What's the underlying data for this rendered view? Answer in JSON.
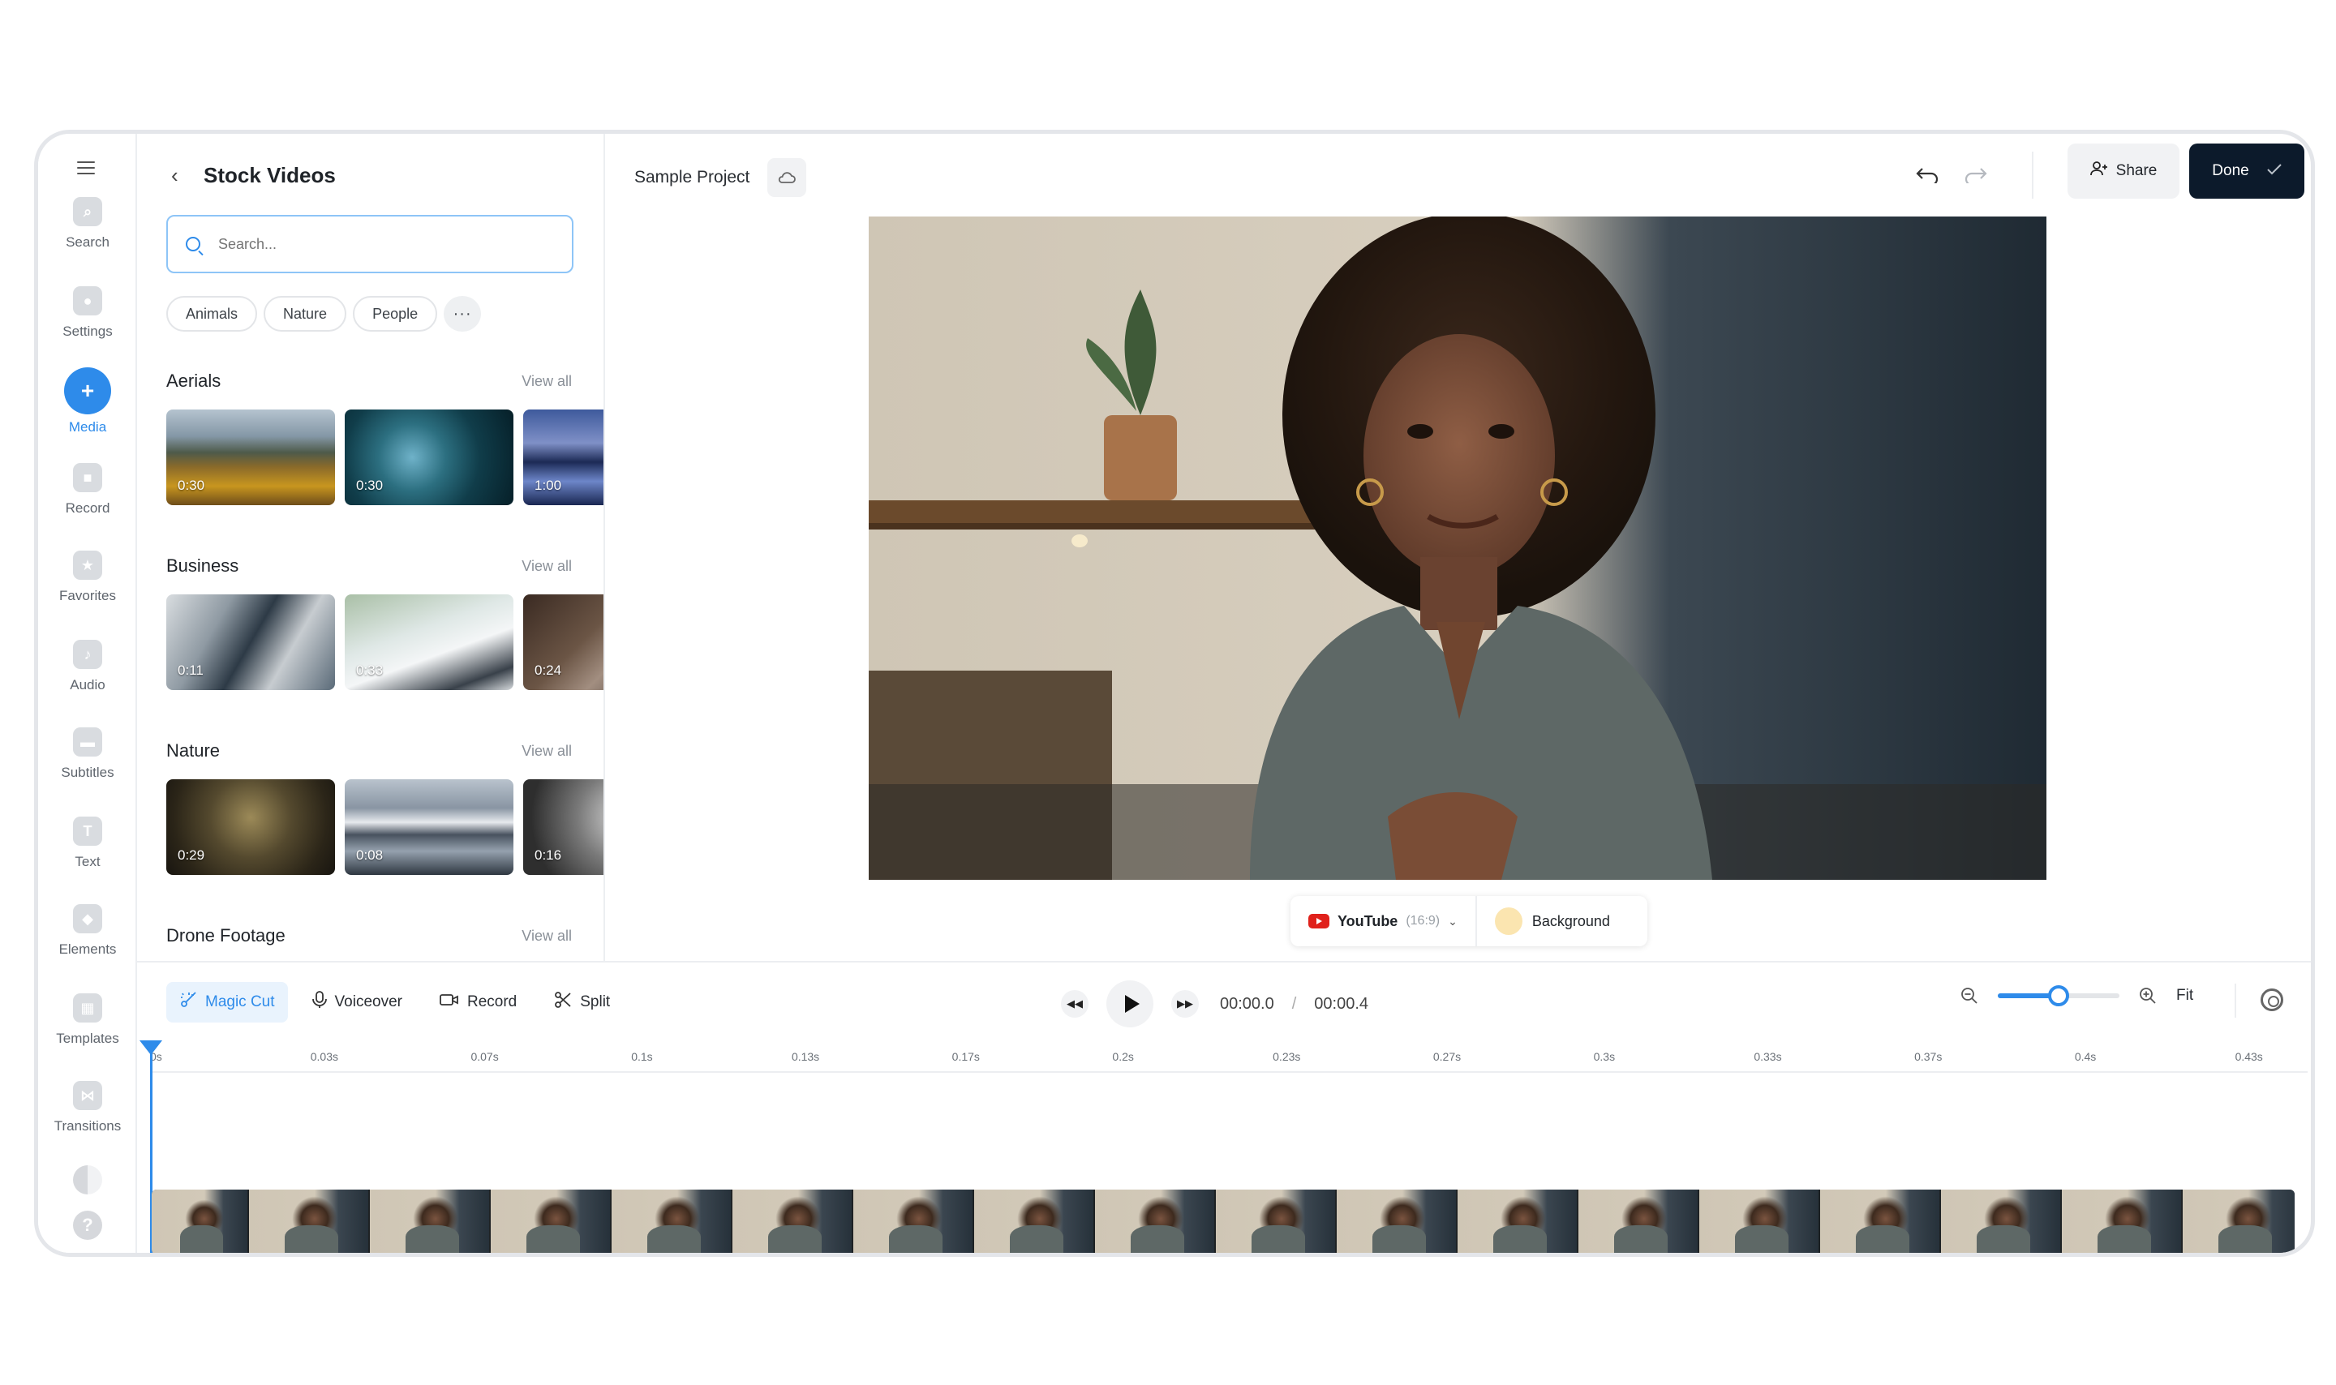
{
  "rail": {
    "items": [
      {
        "label": "Search",
        "icon": "search-icon"
      },
      {
        "label": "Settings",
        "icon": "settings-icon"
      },
      {
        "label": "Media",
        "icon": "plus-icon",
        "active": true
      },
      {
        "label": "Record",
        "icon": "camera-icon"
      },
      {
        "label": "Favorites",
        "icon": "star-icon"
      },
      {
        "label": "Audio",
        "icon": "music-note-icon"
      },
      {
        "label": "Subtitles",
        "icon": "subtitles-icon"
      },
      {
        "label": "Text",
        "icon": "text-icon"
      },
      {
        "label": "Elements",
        "icon": "elements-icon"
      },
      {
        "label": "Templates",
        "icon": "templates-icon"
      },
      {
        "label": "Transitions",
        "icon": "transitions-icon"
      }
    ],
    "help_icon": "help-icon",
    "theme_icon": "theme-toggle-icon"
  },
  "panel": {
    "back_icon": "chevron-left-icon",
    "title": "Stock Videos",
    "search_placeholder": "Search...",
    "chips": [
      "Animals",
      "Nature",
      "People"
    ],
    "more_label": "···",
    "view_all": "View all",
    "sections": [
      {
        "name": "Aerials",
        "durations": [
          "0:30",
          "0:30",
          "1:00"
        ]
      },
      {
        "name": "Business",
        "durations": [
          "0:11",
          "0:33",
          "0:24"
        ]
      },
      {
        "name": "Nature",
        "durations": [
          "0:29",
          "0:08",
          "0:16"
        ]
      },
      {
        "name": "Drone Footage",
        "durations": []
      }
    ]
  },
  "topbar": {
    "project_name": "Sample Project",
    "cloud_icon": "cloud-icon",
    "undo_icon": "undo-icon",
    "redo_icon": "redo-icon",
    "share_label": "Share",
    "done_label": "Done"
  },
  "format": {
    "platform": "YouTube",
    "ratio": "(16:9)",
    "background_label": "Background",
    "background_color": "#fbe5b0"
  },
  "toolbar": {
    "magic_cut": "Magic Cut",
    "voiceover": "Voiceover",
    "record": "Record",
    "split": "Split"
  },
  "transport": {
    "current_time": "00:00.0",
    "separator": "/",
    "total_time": "00:00.4"
  },
  "zoom": {
    "level": 0.5,
    "fit_label": "Fit"
  },
  "ruler": {
    "ticks": [
      "0s",
      "0.03s",
      "0.07s",
      "0.1s",
      "0.13s",
      "0.17s",
      "0.2s",
      "0.23s",
      "0.27s",
      "0.3s",
      "0.33s",
      "0.37s",
      "0.4s",
      "0.43s"
    ]
  },
  "colors": {
    "accent": "#2e8bea",
    "done_bg": "#0c1a2b",
    "youtube_red": "#e0211b"
  }
}
